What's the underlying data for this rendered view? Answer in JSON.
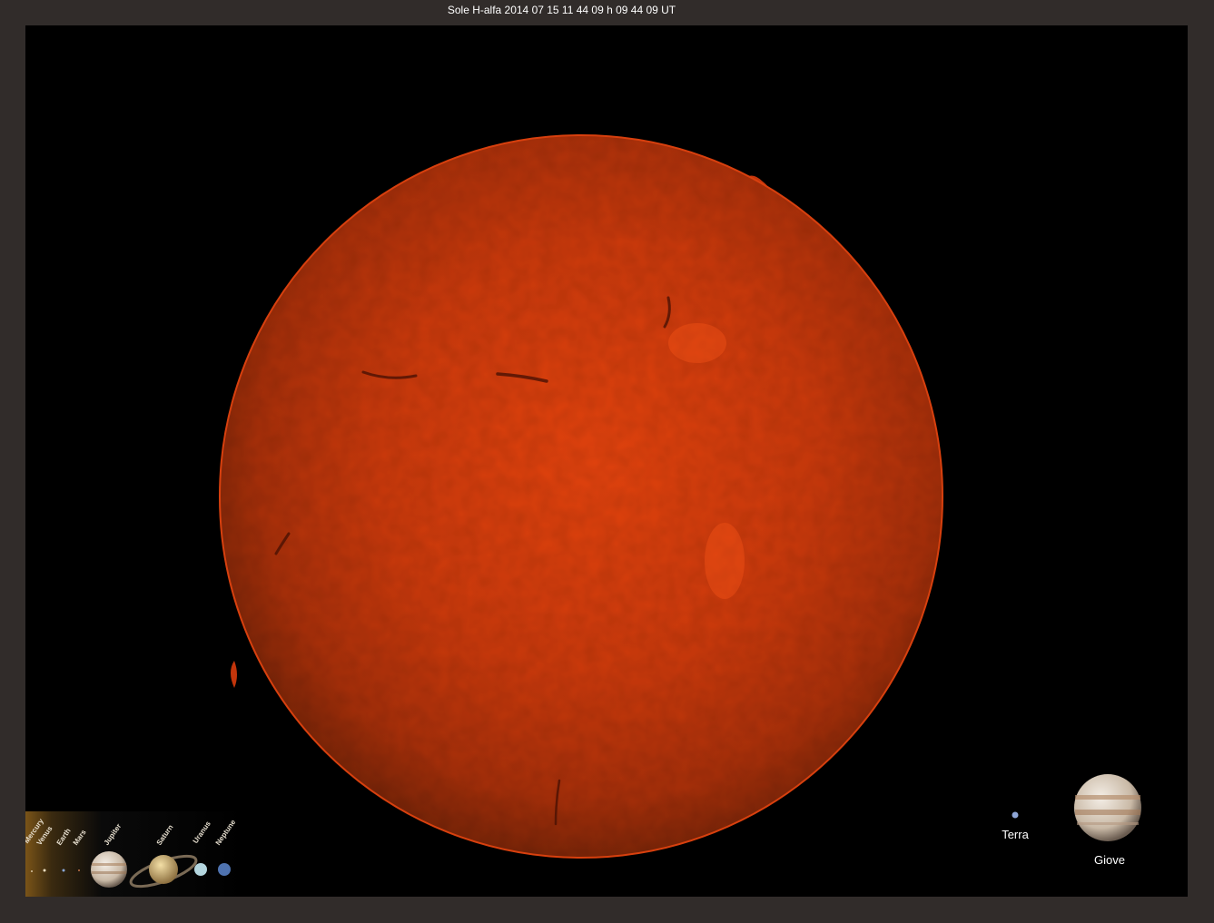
{
  "title": "Sole H-alfa 2014 07 15 11 44 09 h 09 44 09 UT",
  "colors": {
    "background": "#312c2a",
    "frame": "#000000",
    "sun_center": "#e0400c",
    "sun_edge": "#8e2a0a"
  },
  "legend_strip": {
    "labels": [
      "Mercury",
      "Venus",
      "Earth",
      "Mars",
      "Jupiter",
      "Saturn",
      "Uranus",
      "Neptune"
    ]
  },
  "comparison": {
    "earth_label": "Terra",
    "jupiter_label": "Giove"
  }
}
